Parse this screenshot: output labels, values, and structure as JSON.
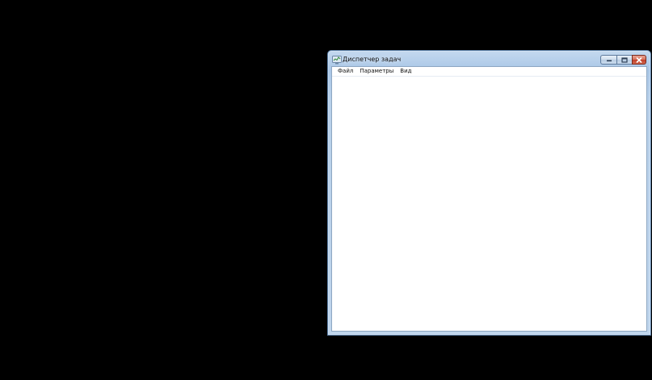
{
  "window": {
    "title": "Диспетчер задач",
    "icon": "task-manager-icon"
  },
  "caption_buttons": {
    "minimize_icon": "minimize-icon",
    "maximize_icon": "maximize-icon",
    "close_icon": "close-icon"
  },
  "menu": {
    "items": [
      {
        "label": "Файл"
      },
      {
        "label": "Параметры"
      },
      {
        "label": "Вид"
      }
    ]
  },
  "colors": {
    "desktop": "#000000",
    "frame": "#b7d0ea",
    "close_button": "#c2402a",
    "client": "#ffffff"
  }
}
